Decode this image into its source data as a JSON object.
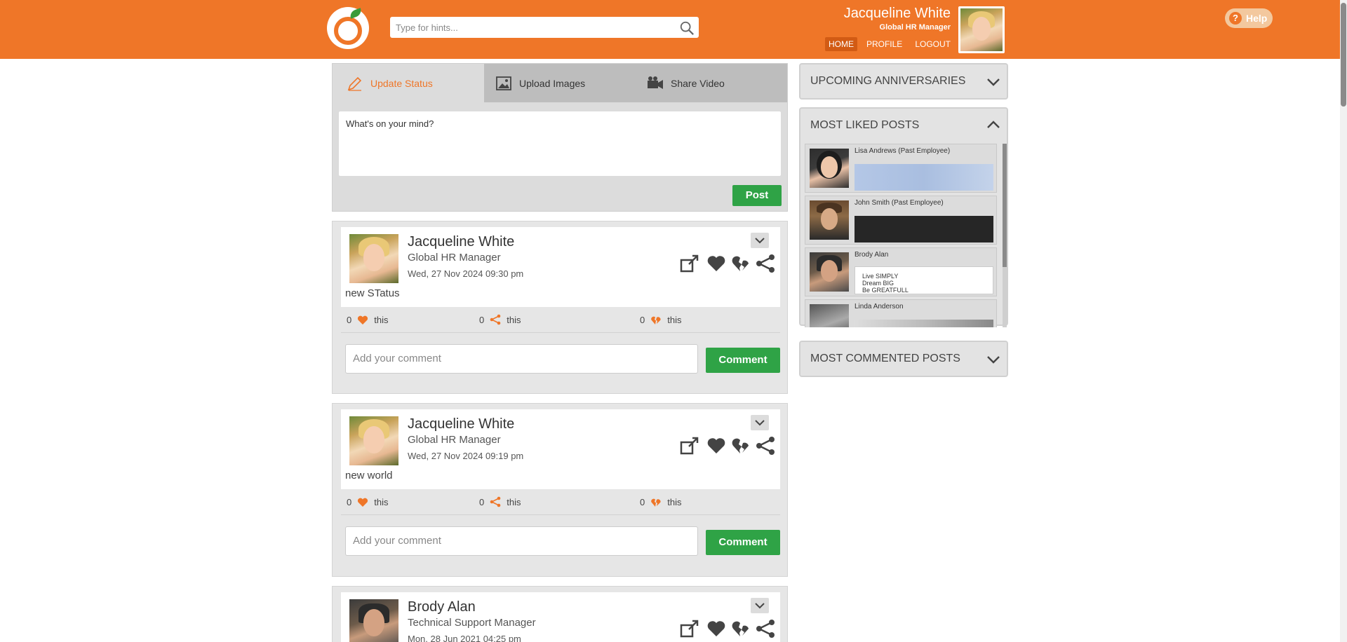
{
  "header": {
    "search_placeholder": "Type for hints...",
    "user_name": "Jacqueline White",
    "user_title": "Global HR Manager",
    "nav": [
      "HOME",
      "PROFILE",
      "LOGOUT"
    ],
    "help_label": "Help",
    "brand_color": "#ef7628"
  },
  "composer": {
    "tabs": [
      "Update Status",
      "Upload Images",
      "Share Video"
    ],
    "placeholder": "What's on your mind?",
    "post_label": "Post"
  },
  "posts": [
    {
      "name": "Jacqueline White",
      "title": "Global HR Manager",
      "date": "Wed, 27 Nov 2024  09:30 pm",
      "text": "new STatus",
      "likes": "0",
      "shares": "0",
      "dislikes": "0",
      "this_label": "this",
      "comment_placeholder": "Add your comment",
      "comment_label": "Comment"
    },
    {
      "name": "Jacqueline White",
      "title": "Global HR Manager",
      "date": "Wed, 27 Nov 2024  09:19 pm",
      "text": "new world",
      "likes": "0",
      "shares": "0",
      "dislikes": "0",
      "this_label": "this",
      "comment_placeholder": "Add your comment",
      "comment_label": "Comment"
    },
    {
      "name": "Brody Alan",
      "title": "Technical Support Manager",
      "date": "Mon, 28 Jun 2021  04:25 pm"
    }
  ],
  "sidebar": {
    "anniversaries": "UPCOMING ANNIVERSARIES",
    "most_liked": "MOST LIKED POSTS",
    "most_commented": "MOST COMMENTED POSTS",
    "liked_posts": [
      {
        "name": "Lisa Andrews (Past Employee)"
      },
      {
        "name": "John Smith (Past Employee)"
      },
      {
        "name": "Brody Alan",
        "lines": [
          "Live SIMPLY",
          "Dream BIG",
          "Be GREATFULL"
        ]
      },
      {
        "name": "Linda Anderson"
      }
    ]
  }
}
